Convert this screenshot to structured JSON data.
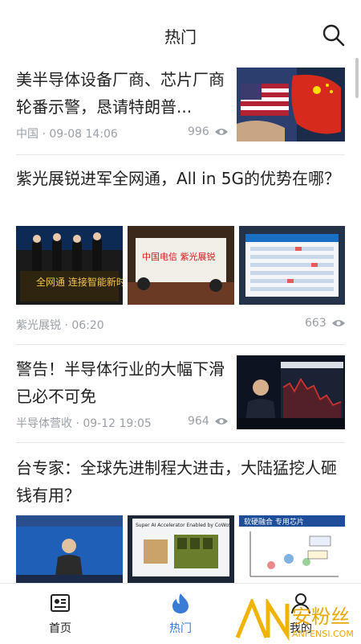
{
  "header": {
    "title": "热门"
  },
  "articles": [
    {
      "title": "美半导体设备厂商、芯片厂商轮番示警，恳请特朗普...",
      "source": "中国",
      "time": "09-08 14:06",
      "views": "996"
    },
    {
      "title": "紫光展锐进军全网通，All in 5G的优势在哪？",
      "source": "紫光展锐",
      "time": "06:20",
      "views": "663"
    },
    {
      "title": "警告！半导体行业的大幅下滑已必不可免",
      "source": "半导体营收",
      "time": "09-12 19:05",
      "views": "964"
    },
    {
      "title": "台专家：全球先进制程大进击，大陆猛挖人砸钱有用？"
    }
  ],
  "thumb_text": {
    "t2a": "全网通 连接智能新时代",
    "t2b": "中国电信 紫光展锐",
    "t4b": "Super AI Accelerator Enabled by CoWoS",
    "t4c": "软硬融合 专用芯片"
  },
  "tabs": [
    {
      "label": "首页",
      "icon": "news-icon"
    },
    {
      "label": "热门",
      "icon": "flame-icon"
    },
    {
      "label": "我的",
      "icon": "person-icon"
    }
  ],
  "watermark": {
    "brand": "安粉丝",
    "site": "ANFENSI.COM"
  },
  "colors": {
    "accent": "#3a7bd5",
    "meta": "#9aa0a6"
  }
}
